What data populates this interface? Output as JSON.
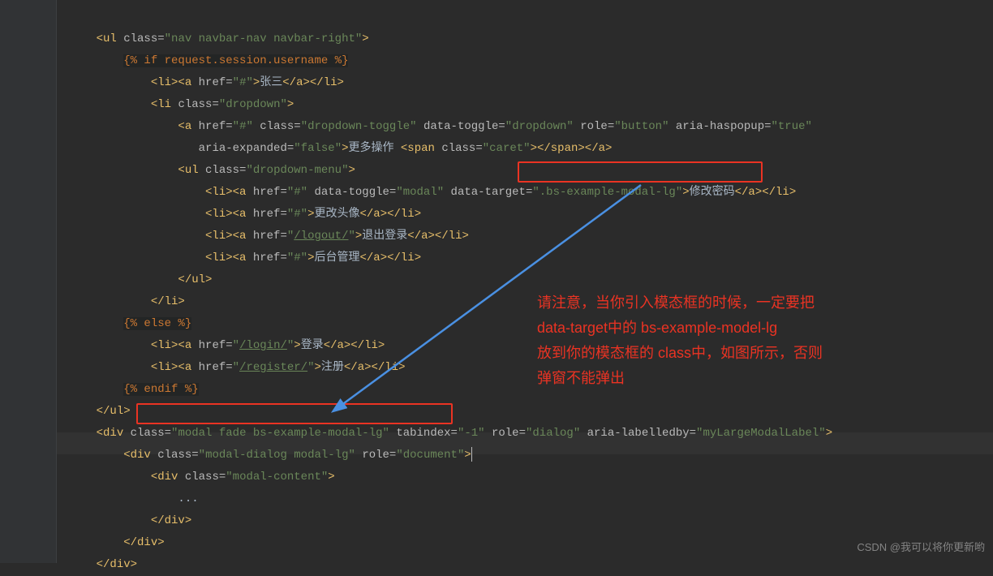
{
  "code": {
    "line1_class": "nav navbar-nav navbar-right",
    "tmpl_if": "{% if request.session.username %}",
    "zhang_san": "张三",
    "dropdown_class": "dropdown",
    "a_href_hash": "#",
    "dropdown_toggle_class": "dropdown-toggle",
    "data_toggle_dropdown": "dropdown",
    "role_button": "button",
    "aria_haspopup": "true",
    "aria_expanded": "false",
    "more_ops": "更多操作 ",
    "caret_class": "caret",
    "dropdown_menu_class": "dropdown-menu",
    "data_toggle_modal": "modal",
    "data_target_val": ".bs-example-modal-lg",
    "change_pwd": "修改密码",
    "change_avatar": "更改头像",
    "logout_href": "/logout/",
    "logout_text": "退出登录",
    "admin_text": "后台管理",
    "tmpl_else": "{% else %}",
    "login_href": "/login/",
    "login_text": "登录",
    "register_href": "/register/",
    "register_text": "注册",
    "tmpl_endif": "{% endif %}",
    "modal_class": "modal fade bs-example-modal-lg",
    "tabindex": "-1",
    "role_dialog": "dialog",
    "aria_labelledby": "myLargeModalLabel",
    "modal_dialog_class": "modal-dialog modal-lg",
    "role_document": "document",
    "modal_content_class": "modal-content",
    "dots": "..."
  },
  "annotation": {
    "line1": "请注意，当你引入模态框的时候，一定要把",
    "line2": "data-target中的 bs-example-model-lg",
    "line3": "放到你的模态框的 class中，如图所示，否则",
    "line4": "弹窗不能弹出"
  },
  "watermark": "CSDN @我可以将你更新哟"
}
